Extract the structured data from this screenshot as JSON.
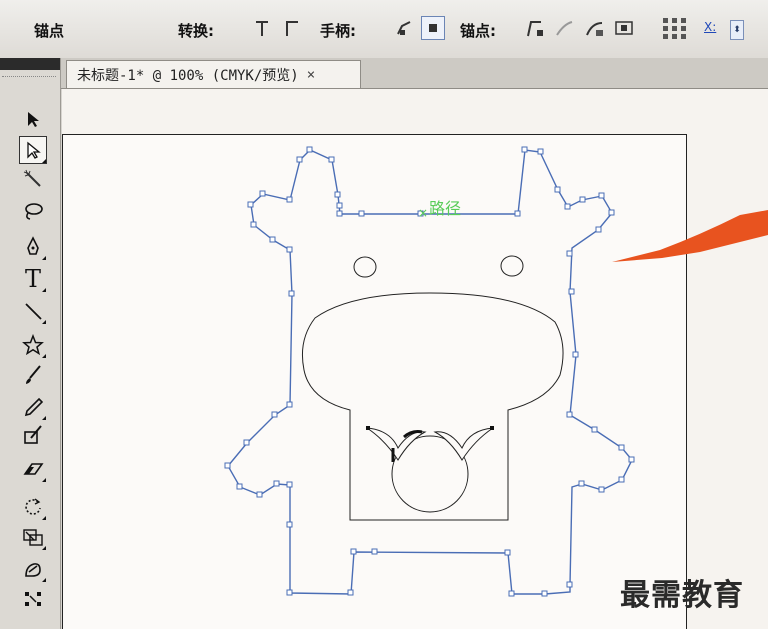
{
  "control_bar": {
    "anchor_label": "锚点",
    "convert_label": "转换:",
    "handle_label": "手柄:",
    "anchor_points_label": "锚点:",
    "x_label": "X:"
  },
  "tab": {
    "title": "未标题-1* @ 100% (CMYK/预览)",
    "close": "×"
  },
  "canvas": {
    "path_label": "路径",
    "path_marker": "×"
  },
  "watermark": "最需教育",
  "colors": {
    "path_blue": "#4a6db5",
    "annotation_arrow": "#e8531f",
    "path_label_green": "#58cc58"
  },
  "tools": [
    "selection-tool",
    "direct-selection-tool",
    "magic-wand-tool",
    "lasso-tool",
    "pen-tool",
    "type-tool",
    "line-tool",
    "star-tool",
    "paintbrush-tool",
    "pencil-tool",
    "blob-brush-tool",
    "eraser-tool",
    "rotate-tool",
    "scale-tool",
    "warp-tool",
    "free-transform-tool"
  ]
}
